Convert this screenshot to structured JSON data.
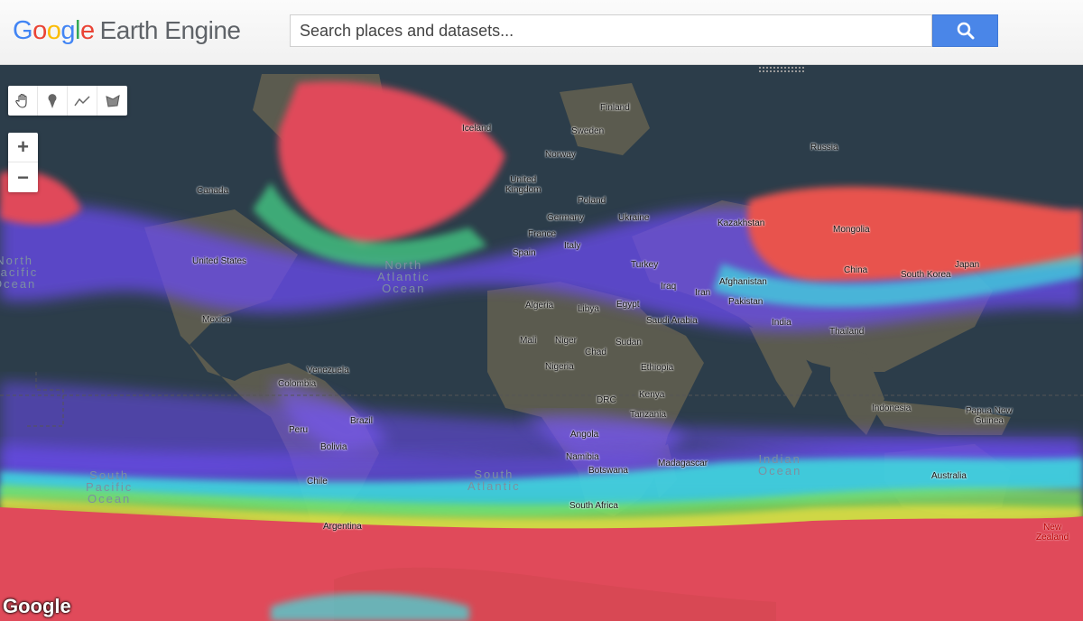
{
  "header": {
    "logo_letters": [
      "G",
      "o",
      "o",
      "g",
      "l",
      "e"
    ],
    "product_name": "Earth Engine",
    "search_placeholder": "Search places and datasets...",
    "search_icon": "search-icon"
  },
  "map": {
    "draw_tools": [
      "hand-pan-icon",
      "marker-icon",
      "polyline-icon",
      "polygon-icon"
    ],
    "zoom_in_label": "+",
    "zoom_out_label": "−",
    "attribution": "Google",
    "country_labels": {
      "finland": "Finland",
      "sweden": "Sweden",
      "norway": "Norway",
      "russia": "Russia",
      "iceland": "Iceland",
      "canada": "Canada",
      "united_kingdom": "United\nKingdom",
      "poland": "Poland",
      "germany": "Germany",
      "ukraine": "Ukraine",
      "france": "France",
      "kazakhstan": "Kazakhstan",
      "mongolia": "Mongolia",
      "italy": "Italy",
      "spain": "Spain",
      "united_states": "United States",
      "turkey": "Turkey",
      "china": "China",
      "south_korea": "South Korea",
      "japan": "Japan",
      "afghanistan": "Afghanistan",
      "iraq": "Iraq",
      "iran": "Iran",
      "pakistan": "Pakistan",
      "algeria": "Algeria",
      "libya": "Libya",
      "egypt": "Egypt",
      "saudi_arabia": "Saudi Arabia",
      "mexico": "Mexico",
      "india": "India",
      "thailand": "Thailand",
      "mali": "Mali",
      "niger": "Niger",
      "chad": "Chad",
      "sudan": "Sudan",
      "nigeria": "Nigeria",
      "ethiopia": "Ethiopia",
      "venezuela": "Venezuela",
      "colombia": "Colombia",
      "kenya": "Kenya",
      "drc": "DRC",
      "tanzania": "Tanzania",
      "indonesia": "Indonesia",
      "papua_new_guinea": "Papua New\nGuinea",
      "brazil": "Brazil",
      "peru": "Peru",
      "angola": "Angola",
      "bolivia": "Bolivia",
      "namibia": "Namibia",
      "madagascar": "Madagascar",
      "botswana": "Botswana",
      "australia": "Australia",
      "chile": "Chile",
      "south_africa": "South Africa",
      "argentina": "Argentina",
      "new_zealand": "New\nZealand"
    },
    "ocean_labels": {
      "north_atlantic": "North\nAtlantic\nOcean",
      "north_pacific": "North\nPacific\nOcean",
      "south_pacific": "South\nPacific\nOcean",
      "south_atlantic": "South\nAtlantic",
      "indian_ocean": "Indian\nOcean"
    },
    "colors": {
      "ocean": "#2c3d4a",
      "land": "#5b5b4f",
      "band_red": "#e04a5a",
      "band_purple": "#6b4cf0",
      "band_cyan": "#3de0e0"
    }
  }
}
